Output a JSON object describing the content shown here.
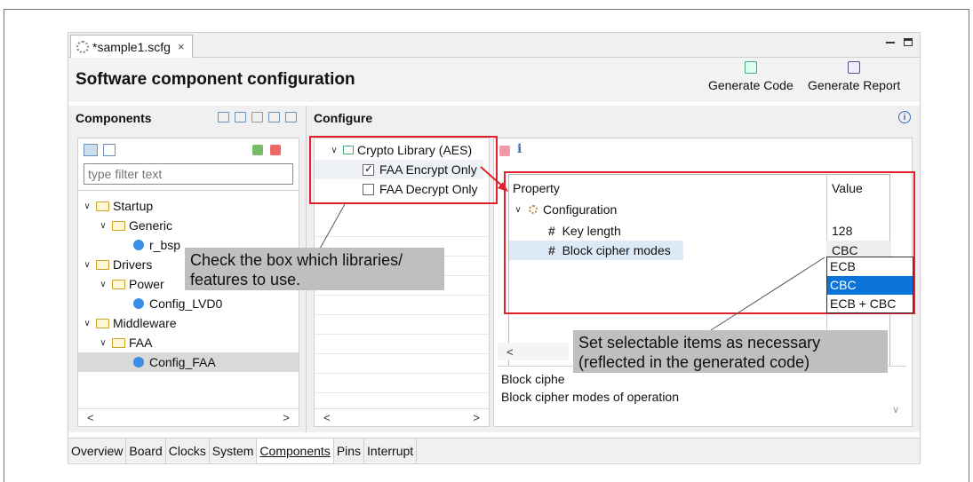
{
  "tab": {
    "title": "*sample1.scfg",
    "close": "×"
  },
  "header": {
    "title": "Software component configuration",
    "generate_code": "Generate Code",
    "generate_report": "Generate Report"
  },
  "components": {
    "title": "Components",
    "filter_placeholder": "type filter text",
    "tree": [
      {
        "label": "Startup",
        "kind": "folder",
        "level": 0
      },
      {
        "label": "Generic",
        "kind": "folder",
        "level": 1
      },
      {
        "label": "r_bsp",
        "kind": "component",
        "level": 2
      },
      {
        "label": "Drivers",
        "kind": "folder",
        "level": 0
      },
      {
        "label": "Power",
        "kind": "folder",
        "level": 1
      },
      {
        "label": "Config_LVD0",
        "kind": "component",
        "level": 2
      },
      {
        "label": "Middleware",
        "kind": "folder",
        "level": 0
      },
      {
        "label": "FAA",
        "kind": "folder",
        "level": 1
      },
      {
        "label": "Config_FAA",
        "kind": "component",
        "level": 2,
        "selected": true
      }
    ]
  },
  "configure": {
    "title": "Configure",
    "library": "Crypto Library (AES)",
    "options": [
      {
        "label": "FAA Encrypt Only",
        "checked": true
      },
      {
        "label": "FAA Decrypt Only",
        "checked": false
      }
    ],
    "table": {
      "col_property": "Property",
      "col_value": "Value",
      "group": "Configuration",
      "rows": [
        {
          "name": "Key length",
          "value": "128"
        },
        {
          "name": "Block cipher modes",
          "value": "CBC"
        }
      ]
    },
    "dropdown_options": [
      "ECB",
      "CBC",
      "ECB + CBC"
    ],
    "dropdown_selected": "CBC",
    "description_partial": "Block ciphe",
    "description": "Block cipher modes of operation"
  },
  "callouts": {
    "left_line1": "Check the box which libraries/",
    "left_line2": "features to use.",
    "right_line1": "Set selectable items as necessary",
    "right_line2": "(reflected in the generated code)"
  },
  "bottom_tabs": [
    "Overview",
    "Board",
    "Clocks",
    "System",
    "Components",
    "Pins",
    "Interrupt"
  ],
  "active_bottom_tab": "Components",
  "colors": {
    "annotation_red": "#e0202a",
    "selection_blue": "#0a74d8"
  }
}
